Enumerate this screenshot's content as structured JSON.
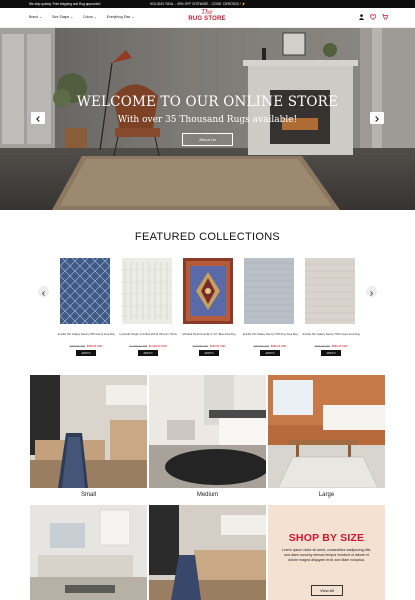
{
  "topbar": {
    "left_text": "We ship quickly. Free shipping and Rug approvals!",
    "promo_text": "HOLIDAY SEAL - 40% OFF SITEWIDE - CODE: DEROS20 / ⚡"
  },
  "header": {
    "nav": [
      {
        "label": "Brand",
        "has_dropdown": true
      },
      {
        "label": "Size Shape",
        "has_dropdown": true
      },
      {
        "label": "Colors",
        "has_dropdown": true
      },
      {
        "label": "Everything Else",
        "has_dropdown": true
      }
    ],
    "logo": {
      "script": "The",
      "name": "RUG STORE"
    },
    "icons": [
      "user-icon",
      "heart-icon",
      "cart-icon"
    ],
    "cart_count": "0"
  },
  "hero": {
    "title": "WELCOME TO OUR ONLINE STORE",
    "subtitle": "With over 35 Thousand Rugs available!",
    "button": "About Us"
  },
  "featured": {
    "title": "FEATURED COLLECTIONS",
    "products": [
      {
        "name": "Jennifer Dirt Galaxy Saxony 5X8 Cherry Area Rug",
        "old_price": "$499.00 USD",
        "new_price": "$299.00 USD",
        "button": "ADD TO",
        "pattern": "blue-lattice"
      },
      {
        "name": "Lymander Single 4 Ch Belt 10X13 Off-Ivory Throw",
        "old_price": "$1,299.00 USD",
        "new_price": "$1,099.00 USD",
        "button": "ADD TO",
        "pattern": "ivory-shag"
      },
      {
        "name": "Mohawk Dinelt Guerrilly 2' 4x7' Blue Area Rug",
        "old_price": "$199.00 USD",
        "new_price": "$169.00 USD",
        "button": "ADD TO",
        "pattern": "persian"
      },
      {
        "name": "Jennifer Dirt Galaxy Saxony 5X8 Grey Area Rug",
        "old_price": "$499.00 USD",
        "new_price": "$299.00 USD",
        "button": "ADD TO",
        "pattern": "grey-textured"
      },
      {
        "name": "Jennifer Dirt Galaxy Saxony 5X8 Cream Area Rug",
        "old_price": "$799.00 USD",
        "new_price": "$599.00 USD",
        "button": "ADD TO",
        "pattern": "cream-textured"
      }
    ]
  },
  "gallery": {
    "tiles": [
      {
        "label": "Small"
      },
      {
        "label": "Medium"
      },
      {
        "label": "Large"
      }
    ]
  },
  "shop_by_size": {
    "title": "SHOP BY SIZE",
    "body": "Lorem ipsum dolor sit amet, consectetur sadipscing elitr, sed diam nonumy eirmod tempor invidunt ut labore et dolore magna aliquyam erat, sed diam voluptua.",
    "button": "View All"
  },
  "colors": {
    "accent_red": "#d0162d",
    "peach_bg": "#f4e1d2",
    "topbar_bg": "#0d0d0d"
  }
}
